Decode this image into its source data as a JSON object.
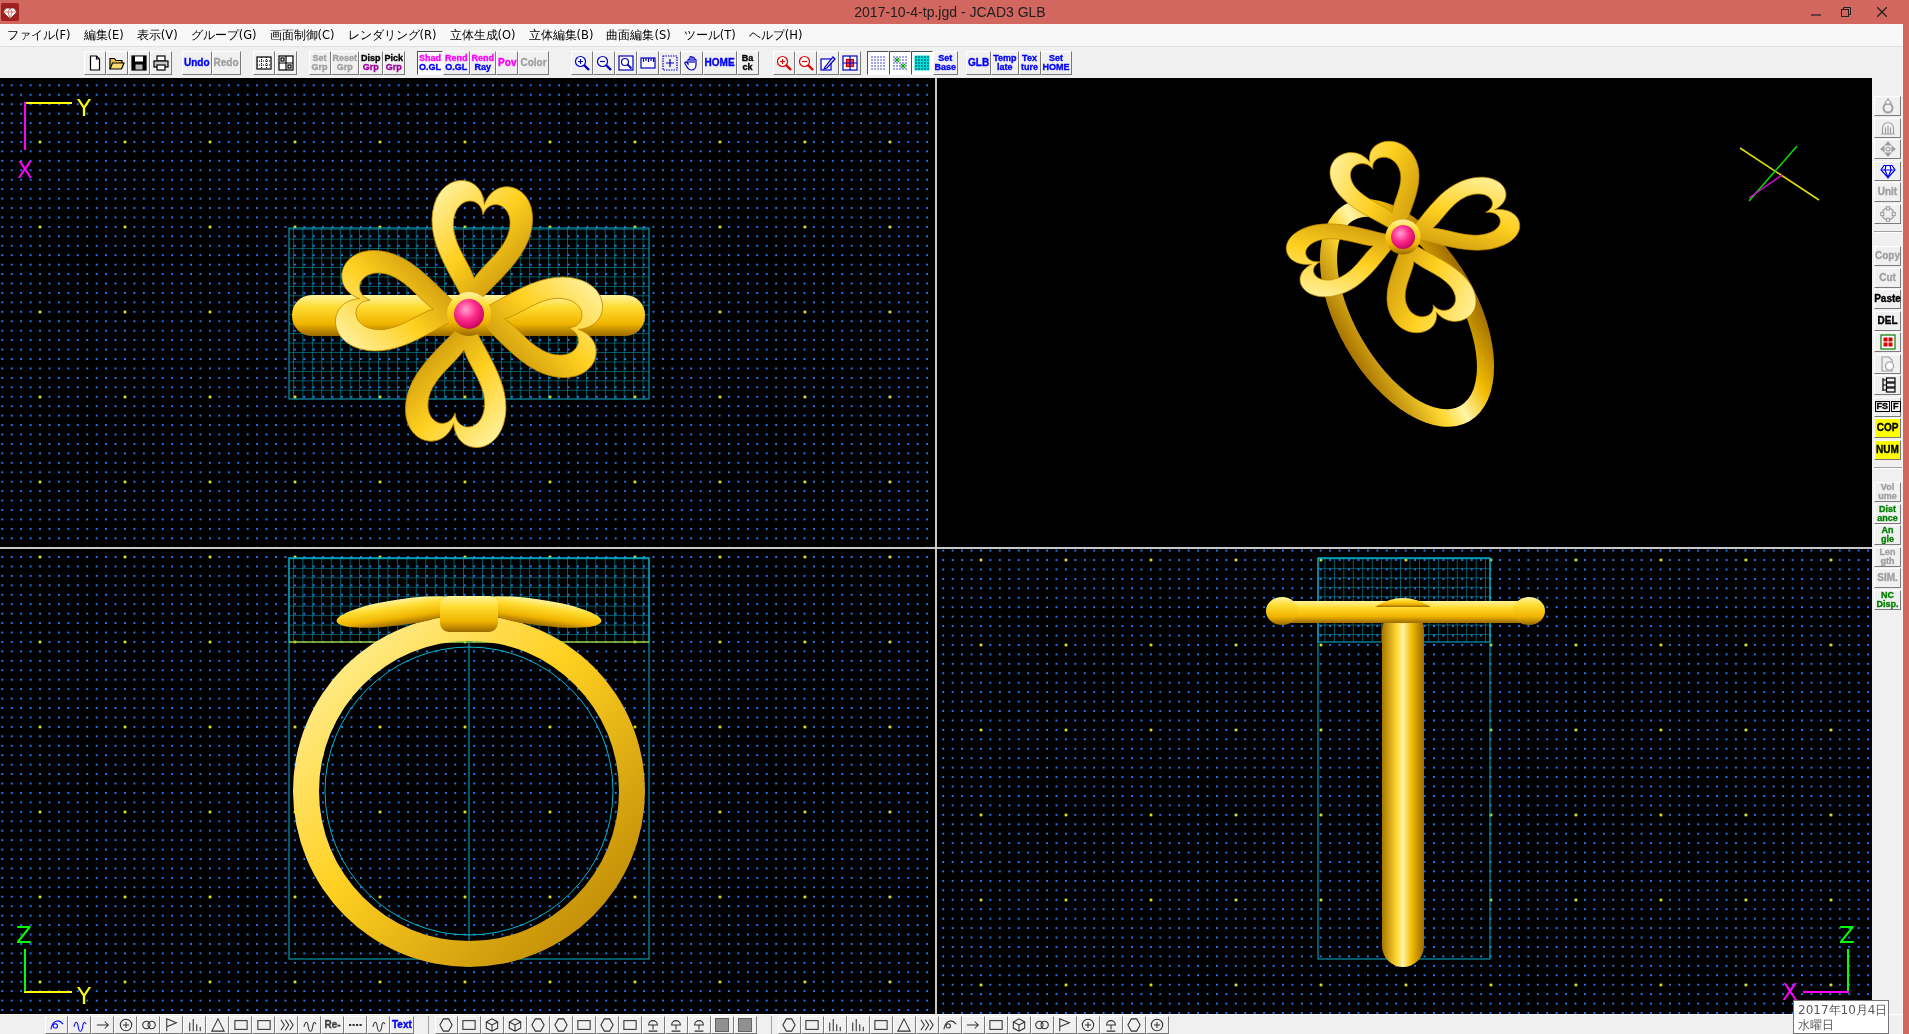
{
  "window": {
    "title": "2017-10-4-tp.jgd - JCAD3 GLB"
  },
  "menu": [
    "ファイル(F)",
    "編集(E)",
    "表示(V)",
    "グループ(G)",
    "画面制御(C)",
    "レンダリング(R)",
    "立体生成(O)",
    "立体編集(B)",
    "曲面編集(S)",
    "ツール(T)",
    "ヘルプ(H)"
  ],
  "toolbar": [
    [
      {
        "kind": "icon",
        "disabled": false,
        "on": false
      },
      {
        "kind": "icon",
        "disabled": false,
        "on": false
      },
      {
        "kind": "icon",
        "disabled": false,
        "on": false
      },
      {
        "kind": "icon",
        "disabled": false,
        "on": false
      }
    ],
    [
      {
        "kind": "text",
        "lines": [
          {
            "text": "Undo",
            "color": "#0000ff"
          }
        ],
        "disabled": false,
        "on": false
      },
      {
        "kind": "text",
        "lines": [
          {
            "text": "Redo"
          }
        ],
        "disabled": true,
        "on": false
      }
    ],
    [
      {
        "kind": "icon",
        "disabled": false,
        "on": false
      },
      {
        "kind": "icon",
        "disabled": false,
        "on": false
      }
    ],
    [
      {
        "kind": "text",
        "lines": [
          {
            "text": "Set"
          },
          {
            "text": "Grp"
          }
        ],
        "disabled": true,
        "on": false
      },
      {
        "kind": "text",
        "lines": [
          {
            "text": "Reset"
          },
          {
            "text": "Grp"
          }
        ],
        "disabled": true,
        "on": false
      },
      {
        "kind": "text",
        "lines": [
          {
            "text": "Disp",
            "color": "#000000"
          },
          {
            "text": "Grp",
            "color": "#a000a0"
          }
        ],
        "disabled": false,
        "on": false
      },
      {
        "kind": "text",
        "lines": [
          {
            "text": "Pick",
            "color": "#000000"
          },
          {
            "text": "Grp",
            "color": "#a000a0"
          }
        ],
        "disabled": false,
        "on": false
      }
    ],
    [
      {
        "kind": "text",
        "lines": [
          {
            "text": "Shad",
            "color": "#ff00ff"
          },
          {
            "text": "O.GL",
            "color": "#0000ff"
          }
        ],
        "disabled": false,
        "on": true
      },
      {
        "kind": "text",
        "lines": [
          {
            "text": "Rend",
            "color": "#ff00ff"
          },
          {
            "text": "O.GL",
            "color": "#0000ff"
          }
        ],
        "disabled": false,
        "on": false
      },
      {
        "kind": "text",
        "lines": [
          {
            "text": "Rend",
            "color": "#ff00ff"
          },
          {
            "text": "Ray",
            "color": "#0000ff"
          }
        ],
        "disabled": false,
        "on": false
      },
      {
        "kind": "text",
        "lines": [
          {
            "text": "Pov",
            "color": "#ff00ff"
          }
        ],
        "disabled": false,
        "on": false
      },
      {
        "kind": "text",
        "lines": [
          {
            "text": "Color"
          }
        ],
        "disabled": true,
        "on": false
      }
    ],
    [
      {
        "kind": "icon",
        "disabled": false,
        "on": false
      },
      {
        "kind": "icon",
        "disabled": false,
        "on": false
      },
      {
        "kind": "icon",
        "disabled": false,
        "on": false
      },
      {
        "kind": "icon",
        "disabled": false,
        "on": false
      },
      {
        "kind": "icon",
        "disabled": false,
        "on": false
      },
      {
        "kind": "icon",
        "disabled": false,
        "on": false
      },
      {
        "kind": "text",
        "lines": [
          {
            "text": "HOME",
            "color": "#0000ff"
          }
        ],
        "disabled": false,
        "on": false
      },
      {
        "kind": "text",
        "lines": [
          {
            "text": "Ba",
            "color": "#000000"
          },
          {
            "text": "ck",
            "color": "#000000"
          }
        ],
        "disabled": false,
        "on": false
      }
    ],
    [
      {
        "kind": "icon",
        "disabled": false,
        "on": false
      },
      {
        "kind": "icon",
        "disabled": false,
        "on": false
      },
      {
        "kind": "icon",
        "disabled": false,
        "on": false
      },
      {
        "kind": "icon",
        "disabled": false,
        "on": false
      }
    ],
    [
      {
        "kind": "icon",
        "disabled": false,
        "on": true
      },
      {
        "kind": "icon",
        "disabled": false,
        "on": true
      },
      {
        "kind": "icon",
        "disabled": false,
        "on": true
      },
      {
        "kind": "text",
        "lines": [
          {
            "text": "Set",
            "color": "#0000ff"
          },
          {
            "text": "Base",
            "color": "#0000ff"
          }
        ],
        "disabled": false,
        "on": false
      }
    ],
    [
      {
        "kind": "text",
        "lines": [
          {
            "text": "GLB",
            "color": "#0000ff"
          }
        ],
        "disabled": false,
        "on": false
      },
      {
        "kind": "text",
        "lines": [
          {
            "text": "Temp",
            "color": "#0000ff"
          },
          {
            "text": "late",
            "color": "#0000ff"
          }
        ],
        "disabled": false,
        "on": false
      },
      {
        "kind": "text",
        "lines": [
          {
            "text": "Tex",
            "color": "#0000ff"
          },
          {
            "text": "ture",
            "color": "#0000ff"
          }
        ],
        "disabled": false,
        "on": false
      },
      {
        "kind": "text",
        "lines": [
          {
            "text": "Set",
            "color": "#0000ff"
          },
          {
            "text": "HOME",
            "color": "#0000ff"
          }
        ],
        "disabled": false,
        "on": false
      }
    ]
  ],
  "viewports": [
    {
      "kind": "top",
      "axes": [
        {
          "label": "Y",
          "color": "#ffff00"
        },
        {
          "label": "X",
          "color": "#ff00ff"
        }
      ]
    },
    {
      "kind": "perspective"
    },
    {
      "kind": "front",
      "axes": [
        {
          "label": "Z",
          "color": "#00ff00"
        },
        {
          "label": "Y",
          "color": "#ffff00"
        }
      ]
    },
    {
      "kind": "side",
      "axes": [
        {
          "label": "Z",
          "color": "#00ff00"
        },
        {
          "label": "X",
          "color": "#ff00ff"
        }
      ]
    }
  ],
  "sidebar": [
    [
      {
        "kind": "icon",
        "disabled": true,
        "on": false
      },
      {
        "kind": "icon",
        "disabled": true,
        "on": false
      },
      {
        "kind": "icon",
        "disabled": true,
        "on": false
      },
      {
        "kind": "icon",
        "disabled": false,
        "on": false
      },
      {
        "kind": "text",
        "lines": [
          {
            "text": "Unit"
          }
        ],
        "disabled": true,
        "on": false
      },
      {
        "kind": "icon",
        "disabled": true,
        "on": false
      }
    ],
    [
      {
        "kind": "text",
        "lines": [
          {
            "text": "Copy"
          }
        ],
        "disabled": true,
        "on": false
      },
      {
        "kind": "text",
        "lines": [
          {
            "text": "Cut"
          }
        ],
        "disabled": true,
        "on": false
      },
      {
        "kind": "text",
        "lines": [
          {
            "text": "Paste",
            "color": "#000000"
          }
        ],
        "disabled": false,
        "on": false
      },
      {
        "kind": "text",
        "lines": [
          {
            "text": "DEL",
            "color": "#000000"
          }
        ],
        "disabled": false,
        "on": false
      },
      {
        "kind": "icon",
        "disabled": false,
        "on": false
      },
      {
        "kind": "icon",
        "disabled": true,
        "on": false
      },
      {
        "kind": "icon",
        "disabled": false,
        "on": false
      },
      {
        "kind": "boxed",
        "lines": [
          {
            "text": "FS",
            "color": "#000000"
          },
          {
            "text": "F",
            "color": "#000000"
          }
        ],
        "disabled": false,
        "on": false
      },
      {
        "kind": "text",
        "lines": [
          {
            "text": "COP",
            "color": "#000000"
          }
        ],
        "disabled": false,
        "on": true
      },
      {
        "kind": "text",
        "lines": [
          {
            "text": "NUM",
            "color": "#000000"
          }
        ],
        "disabled": false,
        "on": true
      }
    ],
    [
      {
        "kind": "text",
        "lines": [
          {
            "text": "Vol"
          },
          {
            "text": "ume"
          }
        ],
        "disabled": true,
        "on": false
      },
      {
        "kind": "text",
        "lines": [
          {
            "text": "Dist",
            "color": "#008000"
          },
          {
            "text": "ance",
            "color": "#008000"
          }
        ],
        "disabled": false,
        "on": false
      },
      {
        "kind": "text",
        "lines": [
          {
            "text": "An",
            "color": "#008000"
          },
          {
            "text": "gle",
            "color": "#008000"
          }
        ],
        "disabled": false,
        "on": false
      },
      {
        "kind": "text",
        "lines": [
          {
            "text": "Len"
          },
          {
            "text": "gth"
          }
        ],
        "disabled": true,
        "on": false
      },
      {
        "kind": "text",
        "lines": [
          {
            "text": "SIM."
          }
        ],
        "disabled": true,
        "on": false
      },
      {
        "kind": "text",
        "lines": [
          {
            "text": "NC",
            "color": "#008000"
          },
          {
            "text": "Disp.",
            "color": "#008000"
          }
        ],
        "disabled": false,
        "on": false
      }
    ]
  ],
  "bottom_toolbar": [
    [
      {
        "kind": "icon"
      },
      {
        "kind": "icon"
      },
      {
        "kind": "icon"
      },
      {
        "kind": "icon"
      },
      {
        "kind": "icon"
      },
      {
        "kind": "icon"
      },
      {
        "kind": "icon"
      },
      {
        "kind": "icon"
      },
      {
        "kind": "icon"
      },
      {
        "kind": "icon"
      },
      {
        "kind": "icon"
      },
      {
        "kind": "icon"
      },
      {
        "kind": "text",
        "lines": [
          {
            "text": "Re-",
            "color": "#404040"
          }
        ]
      },
      {
        "kind": "icon"
      },
      {
        "kind": "icon"
      },
      {
        "kind": "text",
        "lines": [
          {
            "text": "Text",
            "color": "#0000ff"
          }
        ]
      }
    ],
    [
      {
        "kind": "icon"
      },
      {
        "kind": "icon"
      },
      {
        "kind": "icon"
      },
      {
        "kind": "icon"
      },
      {
        "kind": "icon"
      },
      {
        "kind": "icon"
      },
      {
        "kind": "icon"
      },
      {
        "kind": "icon"
      },
      {
        "kind": "icon"
      },
      {
        "kind": "icon"
      },
      {
        "kind": "icon"
      },
      {
        "kind": "icon"
      },
      {
        "kind": "icon"
      },
      {
        "kind": "icon"
      }
    ],
    [
      {
        "kind": "icon"
      },
      {
        "kind": "icon"
      },
      {
        "kind": "icon"
      },
      {
        "kind": "icon"
      },
      {
        "kind": "icon"
      },
      {
        "kind": "icon"
      },
      {
        "kind": "icon"
      },
      {
        "kind": "icon"
      },
      {
        "kind": "icon"
      },
      {
        "kind": "icon"
      },
      {
        "kind": "icon"
      },
      {
        "kind": "icon"
      },
      {
        "kind": "icon"
      },
      {
        "kind": "icon"
      },
      {
        "kind": "icon"
      },
      {
        "kind": "icon"
      },
      {
        "kind": "icon"
      }
    ]
  ],
  "tooltip": {
    "lines": [
      "2017年10月4日",
      "水曜日"
    ]
  }
}
